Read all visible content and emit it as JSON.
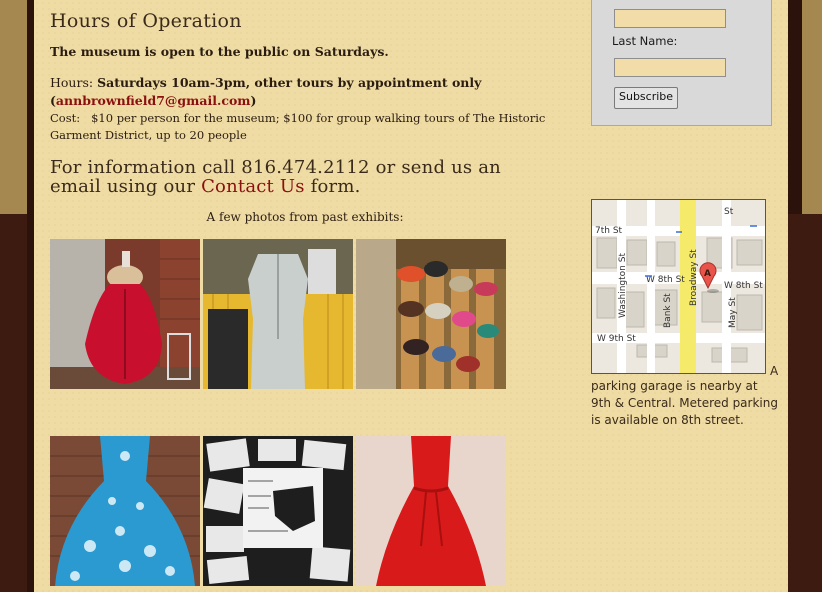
{
  "main": {
    "heading": "Hours of Operation",
    "open_note": "The museum is open to the public on Saturdays.",
    "hours_label": "Hours: ",
    "hours_value": "Saturdays 10am-3pm, other tours by appointment only",
    "paren_open": "(",
    "email": "annbrownfield7@gmail.com",
    "paren_close": ")",
    "cost_label": "Cost: ",
    "cost_value": "$10 per person for the museum; $100 for group walking tours of The Historic Garment District, up to 20 people",
    "info_text": "For information call 816.474.2112 or send us an email using our ",
    "contact_link": "Contact Us",
    "info_suffix": " form.",
    "photos_caption": "A few photos from past exhibits:"
  },
  "sidebar": {
    "last_name_label": "Last Name:",
    "subscribe_label": "Subscribe",
    "map_streets": {
      "seventh": "7th St",
      "broadway": "Broadway St",
      "w8th": "W 8th St",
      "w8th_right": "W 8th St",
      "washington": "Washington St",
      "bank": "Bank St",
      "may": "May St",
      "w9th": "W 9th St",
      "st_top": "St",
      "marker": "A"
    },
    "parking_lead": "A",
    "parking_text": "parking garage is nearby at 9th & Central. Metered parking is available on 8th street."
  }
}
